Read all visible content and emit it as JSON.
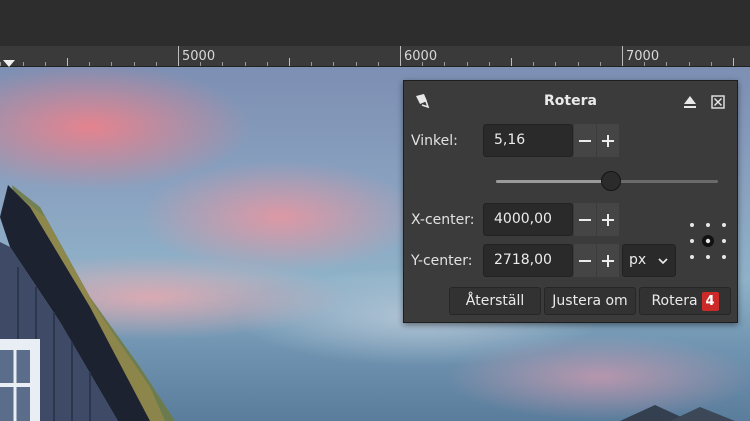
{
  "ruler": {
    "labels": [
      "5000",
      "6000",
      "7000"
    ]
  },
  "dialog": {
    "title": "Rotera",
    "angle": {
      "label": "Vinkel:",
      "value": "5,16",
      "slider_fraction": 0.52
    },
    "x_center": {
      "label": "X-center:",
      "value": "4000,00"
    },
    "y_center": {
      "label": "Y-center:",
      "value": "2718,00"
    },
    "unit": {
      "value": "px"
    },
    "buttons": {
      "reset": "Återställ",
      "readjust": "Justera om",
      "rotate": "Rotera",
      "rotate_badge": "4"
    }
  },
  "colors": {
    "badge": "#cc2929",
    "dialog_bg": "#3b3b3b"
  },
  "icons": [
    "rotate-tool-icon",
    "pin-icon",
    "close-icon",
    "minus-icon",
    "plus-icon",
    "chevron-down-icon",
    "pivot-icon"
  ]
}
